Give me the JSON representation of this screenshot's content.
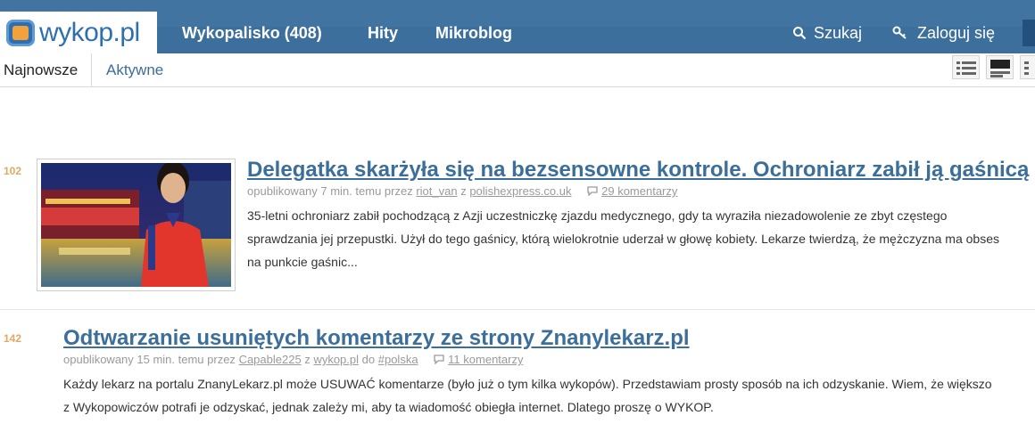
{
  "header": {
    "logo_text": "wykop.pl",
    "nav": [
      "Wykopalisko (408)",
      "Hity",
      "Mikroblog"
    ],
    "search_label": "Szukaj",
    "login_label": "Zaloguj się",
    "brand_color": "#3d6f9c"
  },
  "tabs": {
    "active": "Najnowsze",
    "other": "Aktywne"
  },
  "entries": [
    {
      "score": "102",
      "title": "Delegatka skarżyła się na bezsensowne kontrole. Ochroniarz zabił ją gaśnicą",
      "published": "opublikowany 7 min. temu przez",
      "author": "riot_van",
      "source_prefix": "z",
      "source": "polishexpress.co.uk",
      "comments": "29 komentarzy",
      "desc_lines": [
        "35-letni ochroniarz zabił pochodzącą z Azji uczestniczkę zjazdu medycznego, gdy ta wyraziła niezadowolenie ze zbyt częstego",
        "sprawdzania jej przepustki. Użył do tego gaśnicy, którą wielokrotnie uderzał w głowę kobiety. Lekarze twierdzą, że mężczyzna ma obses",
        "na punkcie gaśnic..."
      ]
    },
    {
      "score": "142",
      "title": "Odtwarzanie usuniętych komentarzy ze strony Znanylekarz.pl",
      "published": "opublikowany 15 min. temu przez",
      "author": "Capable225",
      "source_prefix": "z",
      "source": "wykop.pl",
      "tag_prefix": "do",
      "tag": "#polska",
      "comments": "11 komentarzy",
      "desc_lines": [
        "Każdy lekarz na portalu ZnanyLekarz.pl może USUWAĆ komentarze (było już o tym kilka wykopów). Przedstawiam prosty sposób na ich odzyskanie. Wiem, że większo",
        "z Wykopowiczów potrafi je odzyskać, jednak zależy mi, aby ta wiadomość obiegła internet. Dlatego proszę o WYKOP."
      ]
    }
  ]
}
